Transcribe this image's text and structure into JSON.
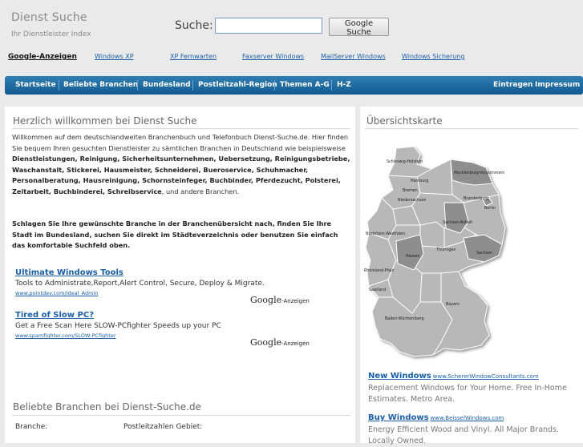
{
  "header": {
    "site_title": "Dienst Suche",
    "site_subtitle": "Ihr Dienstleister Index",
    "search_label": "Suche:",
    "search_value": "",
    "search_button": "Google Suche"
  },
  "ad_links": [
    "Google-Anzeigen",
    "Windows XP",
    "XP Fernwarten",
    "Faxserver Windows",
    "MailServer Windows",
    "Windows Sicherung"
  ],
  "nav": {
    "items": [
      "Startseite",
      "Beliebte Branchen",
      "Bundesland",
      "Postleitzahl-Region",
      "Themen A-G",
      "H-Z"
    ],
    "right_items": [
      "Eintragen",
      "Impressum"
    ]
  },
  "main": {
    "heading": "Herzlich willkommen bei Dienst Suche",
    "intro_lead": "Willkommen auf dem deutschlandweiten Branchenbuch und Telefonbuch Dienst-Suche.de. Hier finden Sie bequem Ihren gesuchten Dienstleister zu sämtlichen Branchen in Deutschland wie beispielsweise",
    "intro_branches": "Dienstleistungen, Reinigung, Sicherheitsunternehmen, Uebersetzung, Reinigungsbetriebe, Waschanstalt, Stickerei, Hausmeister, Schneiderei, Bueroservice, Schuhmacher, Personalberatung, Hausreinigung, Schornsteinfeger, Buchbinder, Pferdezucht, Polsterei, Zeitarbeit, Buchbinderei, Schreibservice",
    "intro_tail": ", und andere Branchen.",
    "cta": "Schlagen Sie Ihre gewünschte Branche in der Branchenübersicht nach, finden Sie Ihre Stadt im Bundesland, suchen Sie direkt im Städteverzeichnis oder benutzen Sie einfach das komfortable Suchfeld oben.",
    "ads": [
      {
        "title": "Ultimate Windows Tools",
        "desc": "Tools to Administrate,Report,Alert Control, Secure, Deploy & Migrate.",
        "url": "www.pointdev.com/Ideal_Admin"
      },
      {
        "title": "Tired of Slow PC?",
        "desc": "Get a Free Scan Here SLOW-PCfighter Speeds up your PC",
        "url": "www.spamfighter.com/SLOW-PCfighter"
      }
    ],
    "google_badge_logo": "Google",
    "google_badge_text": "-Anzeigen",
    "popular_heading": "Beliebte Branchen bei Dienst-Suche.de",
    "col_branche": "Branche:",
    "col_plz": "Postleitzahlen Gebiet:"
  },
  "side": {
    "heading": "Übersichtskarte",
    "map_labels": [
      "Schleswig-Holstein",
      "Mecklenburg-Vorpommern",
      "Hamburg",
      "Bremen",
      "Niedersachsen",
      "Brandenburg",
      "Berlin",
      "Sachsen-Anhalt",
      "Nordrhein-Westfalen",
      "Hessen",
      "Thüringen",
      "Sachsen",
      "Rheinland-Pfalz",
      "Saarland",
      "Baden-Württemberg",
      "Bayern"
    ],
    "ads": [
      {
        "title": "New Windows",
        "url": "www.SchererWindowConsultants.com",
        "desc": "Replacement Windows for Your Home. Free In-Home Estimates. Metro Area."
      },
      {
        "title": "Buy Windows",
        "url": "www.BeisselWindows.com",
        "desc": "Energy Efficient Wood and Vinyl. All Major Brands. Locally Owned."
      }
    ]
  },
  "colors": {
    "nav_bg": "#1e6ea5",
    "link": "#1a5fa8",
    "page_bg": "#eaeaea",
    "map_fill": "#b8b8b8",
    "map_highlight": "#8e8e8e"
  }
}
